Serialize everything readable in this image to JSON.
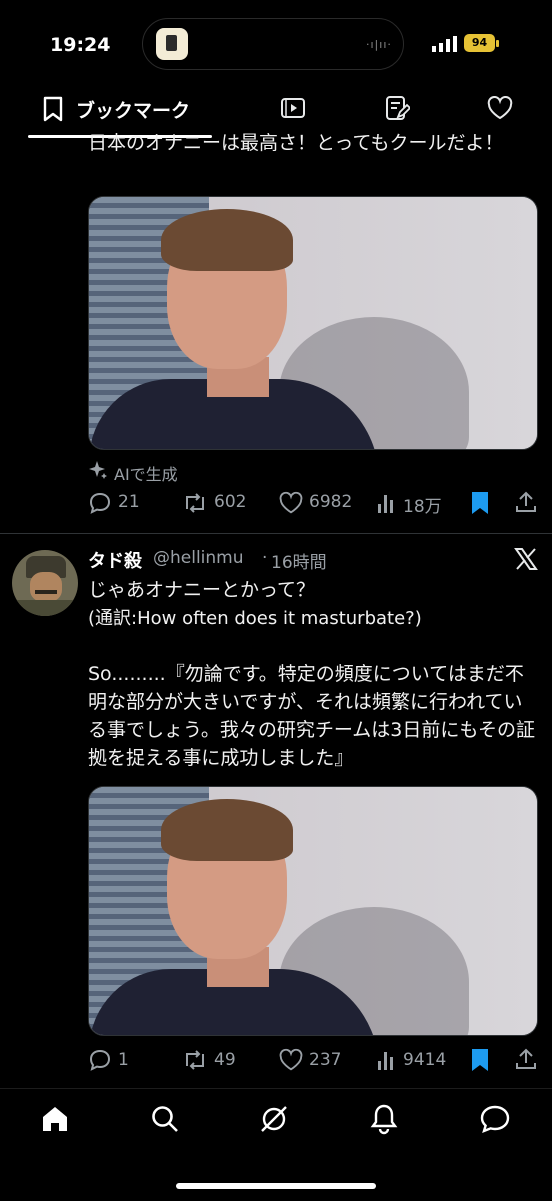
{
  "status_bar": {
    "time": "19:24",
    "battery": "94",
    "wave": "·ı|ıı·"
  },
  "top_tabs": {
    "active_label": "ブックマーク",
    "tabs": [
      "bookmark-icon",
      "video-icon",
      "edit-list-icon",
      "heart-icon"
    ]
  },
  "post1": {
    "text_tail": "日本のオナニーは最高さ！とってもクールだよ！",
    "ai_label": "AIで生成",
    "replies": "21",
    "reposts": "602",
    "likes": "6982",
    "views": "18万"
  },
  "post2": {
    "display_name": "タド殺",
    "handle": "@hellinmu",
    "time": "16時間",
    "text_line1": "じゃあオナニーとかって？",
    "text_line2": "(通訳:How often does it masturbate?)",
    "text_body": "So.........『勿論です。特定の頻度についてはまだ不明な部分が大きいですが、それは頻繁に行われている事でしょう。我々の研究チームは3日前にもその証拠を捉える事に成功しました』",
    "replies": "1",
    "reposts": "49",
    "likes": "237",
    "views": "9414"
  },
  "colors": {
    "accent": "#1d9bf0",
    "muted": "#9aa0a6",
    "battery": "#e6c235"
  }
}
